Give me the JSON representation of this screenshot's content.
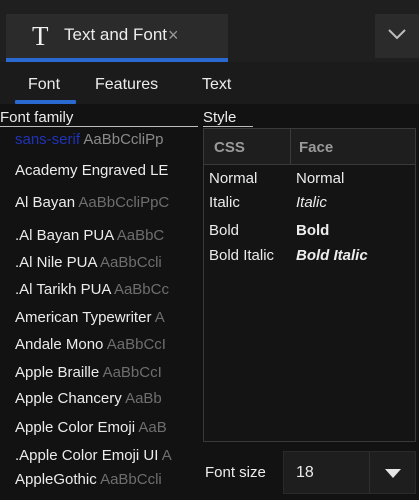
{
  "tab": {
    "icon": "text-T-icon",
    "title": "Text and Font",
    "close_glyph": "×"
  },
  "window_menu": {
    "icon": "chevron-down-icon"
  },
  "subtabs": [
    {
      "label": "Font",
      "active": true
    },
    {
      "label": "Features"
    },
    {
      "label": "Text"
    }
  ],
  "font_family": {
    "label": "Font family",
    "items": [
      {
        "name": "sans-serif",
        "sample": "AaBbCcliPp",
        "selected": true
      },
      {
        "name": "Academy Engraved LE",
        "sample": ""
      },
      {
        "name": "Al Bayan",
        "sample": "AaBbCcliPpC"
      },
      {
        "name": ".Al Bayan PUA",
        "sample": "AaBbC"
      },
      {
        "name": ".Al Nile PUA",
        "sample": "AaBbCcli"
      },
      {
        "name": ".Al Tarikh PUA",
        "sample": "AaBbCc"
      },
      {
        "name": "American Typewriter",
        "sample": "A"
      },
      {
        "name": "Andale Mono",
        "sample": "AaBbCcI"
      },
      {
        "name": "Apple Braille",
        "sample": "AaBbCcI"
      },
      {
        "name": "Apple Chancery",
        "sample": "AaBb"
      },
      {
        "name": "Apple Color Emoji",
        "sample": "AaB"
      },
      {
        "name": ".Apple Color Emoji UI",
        "sample": "A"
      },
      {
        "name": "AppleGothic",
        "sample": "AaBbCcli"
      }
    ]
  },
  "style": {
    "label": "Style",
    "columns": [
      "CSS",
      "Face"
    ],
    "rows": [
      {
        "css": "Normal",
        "face": "Normal"
      },
      {
        "css": "Italic",
        "face": "Italic"
      },
      {
        "css": "Bold",
        "face": "Bold"
      },
      {
        "css": "Bold Italic",
        "face": "Bold Italic"
      }
    ]
  },
  "font_size": {
    "label": "Font size",
    "value": "18"
  },
  "colors": {
    "accent": "#2a6ad0",
    "selected_font": "#1f33b8",
    "background": "#121212"
  }
}
